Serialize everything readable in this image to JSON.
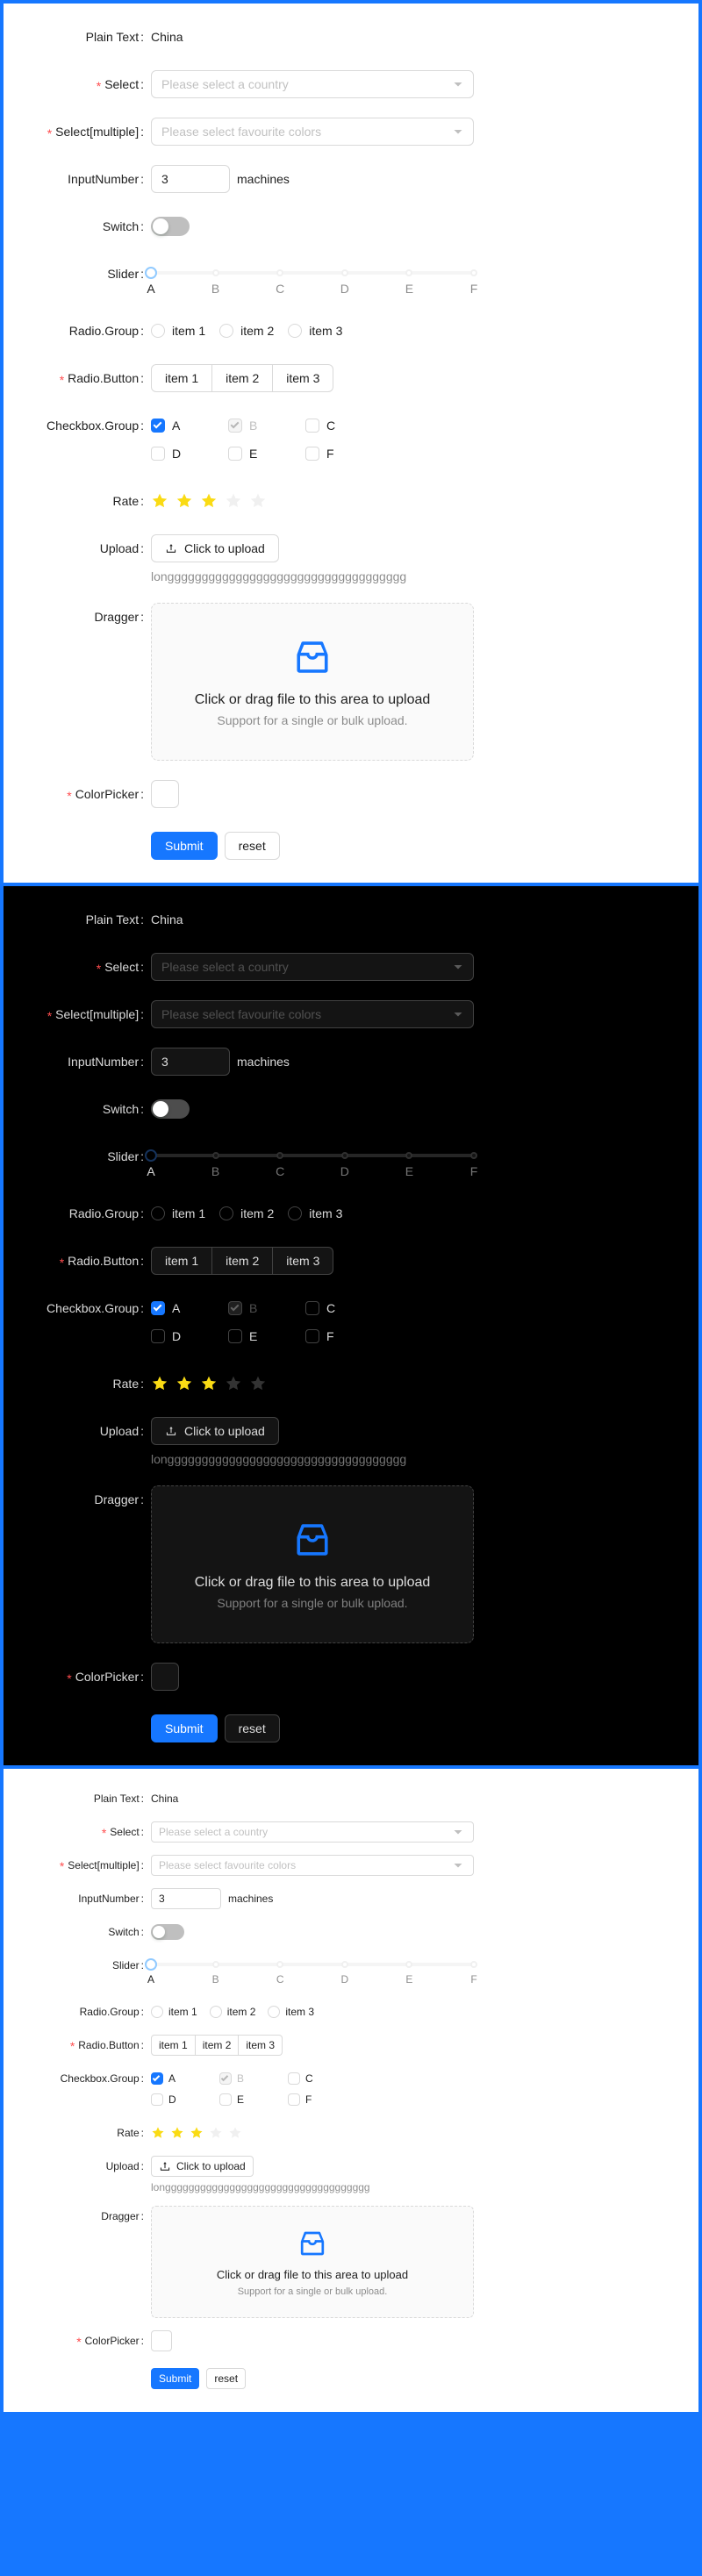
{
  "theme_colors": {
    "page_background": "#1677ff",
    "primary": "#1677ff",
    "required_asterisk": "#ff4d4f",
    "star_active": "#fadb14",
    "star_inactive": "#f0f0f0",
    "light_panel_bg": "#ffffff",
    "dark_panel_bg": "#000000"
  },
  "form": {
    "labels": {
      "plain_text": "Plain Text",
      "select": "Select",
      "select_multiple": "Select[multiple]",
      "input_number": "InputNumber",
      "switch": "Switch",
      "slider": "Slider",
      "radio_group": "Radio.Group",
      "radio_button": "Radio.Button",
      "checkbox_group": "Checkbox.Group",
      "rate": "Rate",
      "upload": "Upload",
      "dragger": "Dragger",
      "color_picker": "ColorPicker"
    },
    "plain_text_value": "China",
    "select": {
      "placeholder": "Please select a country",
      "value": "",
      "icon": "chevron-down-icon"
    },
    "select_multiple": {
      "placeholder": "Please select favourite colors",
      "value": "",
      "icon": "chevron-down-icon"
    },
    "input_number": {
      "value": "3",
      "suffix": "machines"
    },
    "switch": {
      "checked": false
    },
    "slider": {
      "marks": [
        "A",
        "B",
        "C",
        "D",
        "E",
        "F"
      ],
      "value_index": 0,
      "positions": [
        0,
        20,
        40,
        60,
        80,
        100
      ]
    },
    "radio_group": {
      "options": [
        "item 1",
        "item 2",
        "item 3"
      ],
      "selected": ""
    },
    "radio_button": {
      "options": [
        "item 1",
        "item 2",
        "item 3"
      ],
      "selected": ""
    },
    "checkbox_group": {
      "options": [
        {
          "label": "A",
          "checked": true,
          "disabled": false
        },
        {
          "label": "B",
          "checked": true,
          "disabled": true
        },
        {
          "label": "C",
          "checked": false,
          "disabled": false
        },
        {
          "label": "D",
          "checked": false,
          "disabled": false
        },
        {
          "label": "E",
          "checked": false,
          "disabled": false
        },
        {
          "label": "F",
          "checked": false,
          "disabled": false
        }
      ]
    },
    "rate": {
      "value": 3,
      "count": 5,
      "icon": "star-icon"
    },
    "upload": {
      "button_label": "Click to upload",
      "button_icon": "upload-icon",
      "file_name": "longgggggggggggggggggggggggggggggggggg"
    },
    "dragger": {
      "icon": "inbox-icon",
      "title": "Click or drag file to this area to upload",
      "hint": "Support for a single or bulk upload."
    },
    "color_picker": {
      "value": "transparent"
    },
    "footer": {
      "submit_label": "Submit",
      "reset_label": "reset"
    }
  },
  "panels": [
    {
      "id": "light",
      "theme": "light"
    },
    {
      "id": "dark",
      "theme": "dark"
    },
    {
      "id": "compact",
      "theme": "compact"
    }
  ]
}
